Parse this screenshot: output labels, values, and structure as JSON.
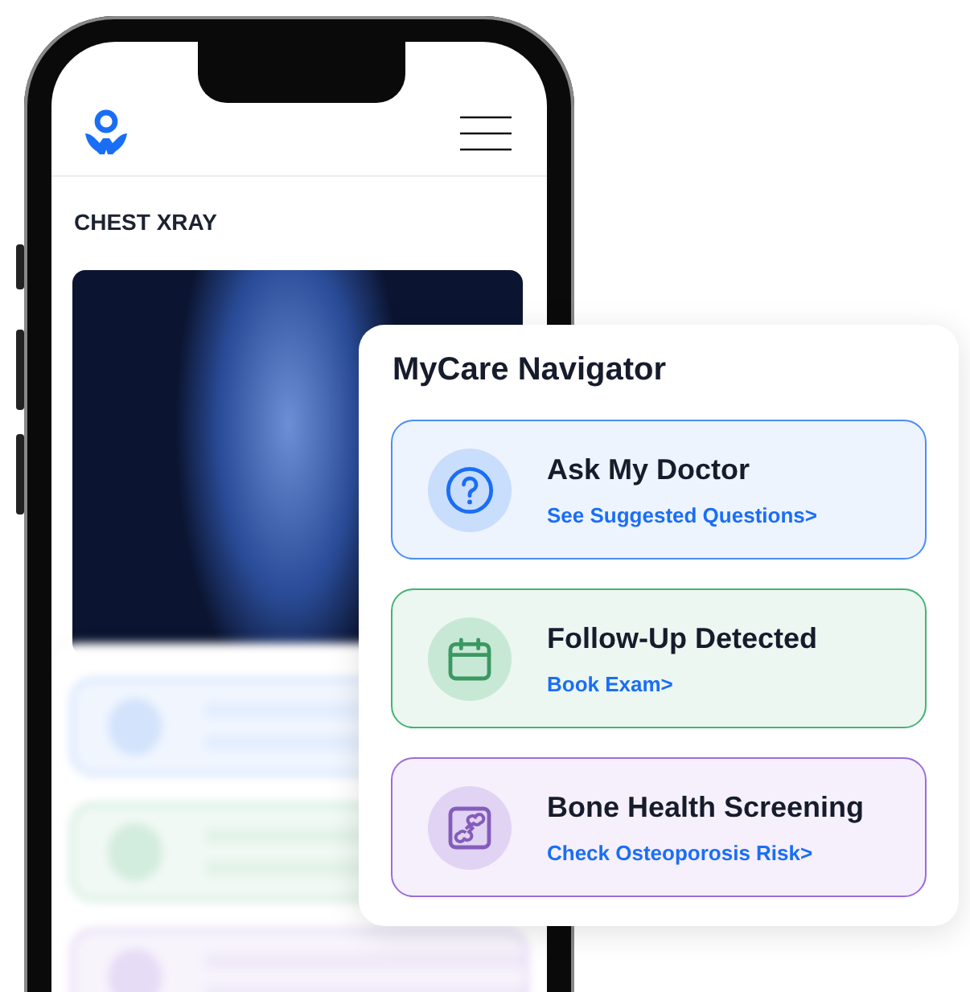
{
  "phone": {
    "section_title": "CHEST XRAY"
  },
  "navigator": {
    "title": "MyCare Navigator",
    "items": [
      {
        "kind": "question",
        "title": "Ask My Doctor",
        "link": "See Suggested Questions>",
        "color": "#4a8ef5"
      },
      {
        "kind": "calendar",
        "title": "Follow-Up Detected",
        "link": "Book Exam>",
        "color": "#45b374"
      },
      {
        "kind": "bone",
        "title": "Bone Health Screening",
        "link": "Check Osteoporosis Risk>",
        "color": "#9b6ddb"
      }
    ]
  }
}
